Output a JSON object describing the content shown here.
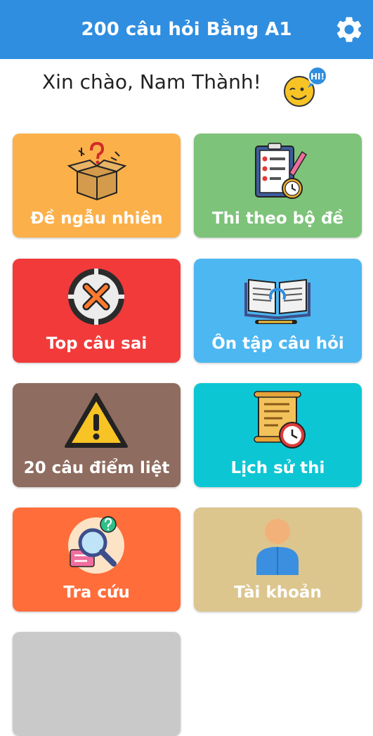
{
  "app_bar": {
    "title": "200 câu hỏi Bằng A1",
    "settings_icon": "gear-icon"
  },
  "greeting": {
    "text": "Xin chào, Nam Thành!",
    "badge_text": "HI!"
  },
  "tiles": [
    {
      "label": "Đề ngẫu nhiên",
      "color": "#fbb04a",
      "icon": "mystery-box-icon"
    },
    {
      "label": "Thi theo bộ đề",
      "color": "#7dc37a",
      "icon": "checklist-clipboard-icon"
    },
    {
      "label": "Top câu sai",
      "color": "#f23a3a",
      "icon": "wrong-x-icon"
    },
    {
      "label": "Ôn tập câu hỏi",
      "color": "#4db7f2",
      "icon": "open-book-icon"
    },
    {
      "label": "20 câu điểm liệt",
      "color": "#8e6c5f",
      "icon": "warning-icon"
    },
    {
      "label": "Lịch sử thi",
      "color": "#0dc6d4",
      "icon": "scroll-clock-icon"
    },
    {
      "label": "Tra cứu",
      "color": "#ff6d3a",
      "icon": "search-lookup-icon"
    },
    {
      "label": "Tài khoản",
      "color": "#dcc68e",
      "icon": "user-account-icon"
    }
  ],
  "colors": {
    "app_bar": "#2f8ee0",
    "background": "#ffffff"
  }
}
